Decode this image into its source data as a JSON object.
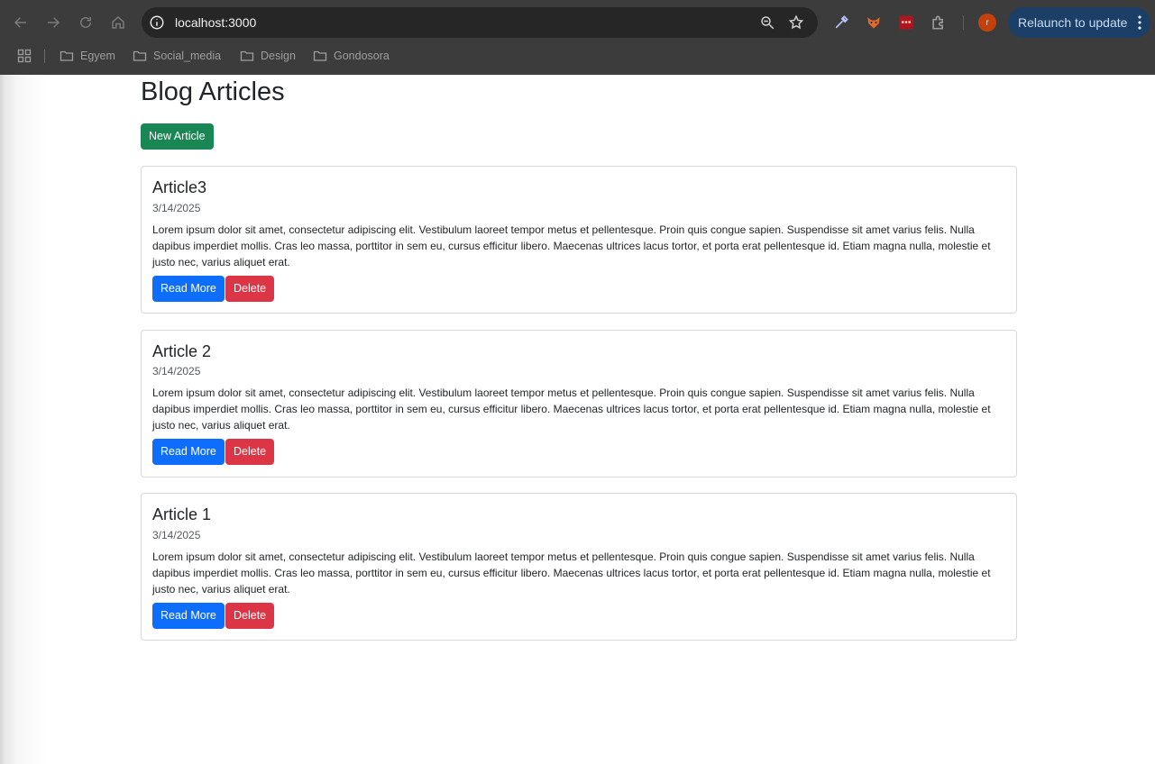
{
  "browser": {
    "url": "localhost:3000",
    "relaunch_label": "Relaunch to update",
    "avatar_letter": "r",
    "accent_color": "#1b3f66",
    "bookmarks": [
      {
        "label": "Egyem"
      },
      {
        "label": "Social_media"
      },
      {
        "label": "Design"
      },
      {
        "label": "Gondosora"
      }
    ]
  },
  "page": {
    "title": "Blog Articles",
    "new_article_label": "New Article",
    "articles": [
      {
        "title": "Article3",
        "date": "3/14/2025",
        "body": "Lorem ipsum dolor sit amet, consectetur adipiscing elit. Vestibulum laoreet tempor metus et pellentesque. Proin quis congue sapien. Suspendisse sit amet varius felis. Nulla dapibus imperdiet mollis. Cras leo massa, porttitor in sem eu, cursus efficitur libero. Maecenas ultrices lacus tortor, et porta erat pellentesque id. Etiam magna nulla, molestie et justo nec, varius aliquet erat.",
        "read_more_label": "Read More",
        "delete_label": "Delete"
      },
      {
        "title": "Article 2",
        "date": "3/14/2025",
        "body": "Lorem ipsum dolor sit amet, consectetur adipiscing elit. Vestibulum laoreet tempor metus et pellentesque. Proin quis congue sapien. Suspendisse sit amet varius felis. Nulla dapibus imperdiet mollis. Cras leo massa, porttitor in sem eu, cursus efficitur libero. Maecenas ultrices lacus tortor, et porta erat pellentesque id. Etiam magna nulla, molestie et justo nec, varius aliquet erat.",
        "read_more_label": "Read More",
        "delete_label": "Delete"
      },
      {
        "title": "Article 1",
        "date": "3/14/2025",
        "body": "Lorem ipsum dolor sit amet, consectetur adipiscing elit. Vestibulum laoreet tempor metus et pellentesque. Proin quis congue sapien. Suspendisse sit amet varius felis. Nulla dapibus imperdiet mollis. Cras leo massa, porttitor in sem eu, cursus efficitur libero. Maecenas ultrices lacus tortor, et porta erat pellentesque id. Etiam magna nulla, molestie et justo nec, varius aliquet erat.",
        "read_more_label": "Read More",
        "delete_label": "Delete"
      }
    ]
  },
  "colors": {
    "success": "#198754",
    "primary": "#0d6efd",
    "danger": "#dc3545"
  }
}
